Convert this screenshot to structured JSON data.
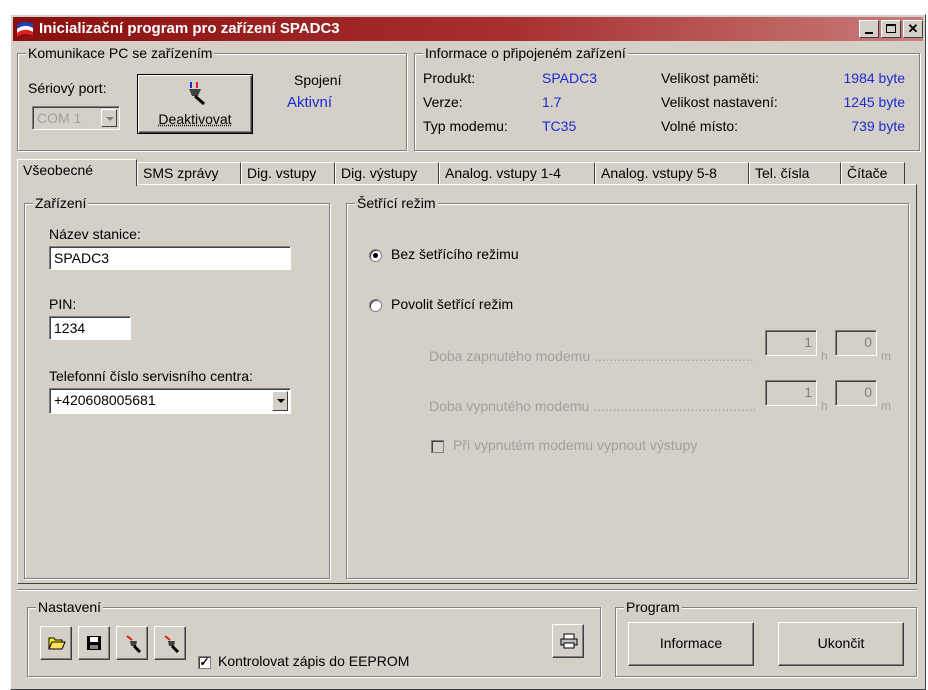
{
  "window": {
    "title": "Inicializační program pro zařízení SPADC3"
  },
  "comm": {
    "group_label": "Komunikace PC se zařízením",
    "port_label": "Sériový port:",
    "port_value": "COM 1",
    "connect_button": "Deaktivovat",
    "connection_label": "Spojení",
    "connection_status": "Aktivní"
  },
  "device_info": {
    "group_label": "Informace o připojeném zařízení",
    "product_label": "Produkt:",
    "product_value": "SPADC3",
    "version_label": "Verze:",
    "version_value": "1.7",
    "modem_label": "Typ modemu:",
    "modem_value": "TC35",
    "memory_label": "Velikost paměti:",
    "memory_value": "1984 byte",
    "settings_label": "Velikost nastavení:",
    "settings_value": "1245 byte",
    "free_label": "Volné místo:",
    "free_value": "739 byte"
  },
  "tabs": [
    {
      "label": "Všeobecné",
      "active": true
    },
    {
      "label": "SMS zprávy"
    },
    {
      "label": "Dig. vstupy"
    },
    {
      "label": "Dig. výstupy"
    },
    {
      "label": "Analog. vstupy 1-4"
    },
    {
      "label": "Analog. vstupy 5-8"
    },
    {
      "label": "Tel. čísla"
    },
    {
      "label": "Čítače"
    }
  ],
  "device": {
    "group_label": "Zařízení",
    "station_label": "Název stanice:",
    "station_value": "SPADC3",
    "pin_label": "PIN:",
    "pin_value": "1234",
    "service_label": "Telefonní číslo servisního centra:",
    "service_value": "+420608005681"
  },
  "saving": {
    "group_label": "Šetřící režim",
    "option_off": "Bez šetřícího režimu",
    "option_on": "Povolit šetřící režim",
    "selected": "off",
    "on_time_label": "Doba zapnutého modemu ..........................................",
    "off_time_label": "Doba vypnutého modemu ...........................................",
    "on_hours": "1",
    "on_minutes": "0",
    "off_hours": "1",
    "off_minutes": "0",
    "unit_h": "h",
    "unit_m": "m",
    "outputs_off_label": "Při vypnutém modemu vypnout výstupy",
    "outputs_off_checked": false
  },
  "settings": {
    "group_label": "Nastavení",
    "verify_label": "Kontrolovat zápis do EEPROM",
    "verify_checked": true,
    "check_mark": "✓"
  },
  "program": {
    "group_label": "Program",
    "info_button": "Informace",
    "exit_button": "Ukončit"
  },
  "colors": {
    "title_start": "#8a1010",
    "title_end": "#c97c7c",
    "accent_blue": "#1a2bd6",
    "face": "#d4d0c8"
  }
}
